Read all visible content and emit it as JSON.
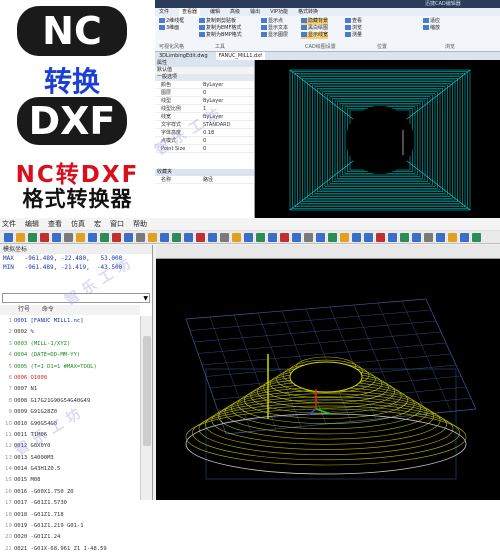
{
  "promo": {
    "nc_text": "NC",
    "convert_text": "转换",
    "dxf_text": "DXF",
    "line1": "NC转DXF",
    "line2": "格式转换器",
    "nc_text_color": "#ffffff",
    "line1_color": "#d8101c",
    "convert_color": "#1c3fd6"
  },
  "cad_window": {
    "title": "迅捷CAD编辑器",
    "tabs": [
      "文件",
      "查看器",
      "编辑",
      "高级",
      "输出",
      "VIP功能",
      "格式转换"
    ],
    "active_tab": "查看器",
    "ribbon": {
      "group1": [
        "2维线框",
        "3维面",
        "可视化风格"
      ],
      "group2": [
        "复制到剪贴板",
        "复制为EMF格式",
        "复制为BMP格式",
        "工具"
      ],
      "group3": [
        "显示点",
        "显示文本",
        "显示图层",
        "CAD绘图设置"
      ],
      "group4": [
        "隐藏背景",
        "黑白绘图",
        "显示线宽",
        "位置"
      ],
      "group5": [
        "查看",
        "浏览",
        "测量"
      ],
      "group6": [
        "适应",
        "缩放",
        "浏览"
      ]
    },
    "file_tabs": [
      "3DLimbingEdit.dwg",
      "FANUC_MILL1.dxf"
    ],
    "props_title": "属性",
    "props_subtitle": "默认值",
    "props_section": "一般选项",
    "properties": [
      {
        "key": "颜色",
        "value": "ByLayer"
      },
      {
        "key": "图层",
        "value": "0"
      },
      {
        "key": "线型",
        "value": "ByLayer"
      },
      {
        "key": "线型比例",
        "value": "1"
      },
      {
        "key": "线宽",
        "value": "ByLayer"
      },
      {
        "key": "文字样式",
        "value": "STANDARD"
      },
      {
        "key": "字体高度",
        "value": "0.18"
      },
      {
        "key": "点模式",
        "value": "0"
      },
      {
        "key": "Point Size",
        "value": "0"
      }
    ],
    "favorites_title": "收藏夹",
    "favorites_cols": [
      "名称",
      "路径"
    ],
    "accent_color": "#00e5e5"
  },
  "nc_editor": {
    "menu": [
      "文件",
      "编辑",
      "查看",
      "仿真",
      "宏",
      "窗口",
      "帮助"
    ],
    "coord_title": "模拟坐标",
    "coord_rows": [
      "MAX   -961.489, -22.480,   53.000",
      "MIN   -961.489, -21.419,  -43.500"
    ],
    "code_header": [
      "行号",
      "命令"
    ],
    "code_lines": [
      {
        "n": "1",
        "text": "O001 [FANUC MILL1.nc]",
        "color": "#1a2fc4"
      },
      {
        "n": "2",
        "text": "O002 %",
        "color": "#333333"
      },
      {
        "n": "3",
        "text": "O003 (MILL-1/XYZ)",
        "color": "#1f8a1f"
      },
      {
        "n": "4",
        "text": "O004 (DATE=DD-MM-YY)",
        "color": "#1f8a1f"
      },
      {
        "n": "5",
        "text": "O005 (T=1 D1=1 #MAX=TOOL)",
        "color": "#1f8a1f"
      },
      {
        "n": "6",
        "text": "O006 O1000",
        "color": "#d81c1c"
      },
      {
        "n": "7",
        "text": "O007 N1",
        "color": "#333333"
      },
      {
        "n": "8",
        "text": "O008 G17G21G90G54G40G49",
        "color": "#333333"
      },
      {
        "n": "9",
        "text": "O009 G91G28Z0",
        "color": "#333333"
      },
      {
        "n": "10",
        "text": "O010 G90G54G0",
        "color": "#333333"
      },
      {
        "n": "11",
        "text": "O011 T1M06",
        "color": "#333333"
      },
      {
        "n": "12",
        "text": "O012 G0X0Y0",
        "color": "#333333"
      },
      {
        "n": "13",
        "text": "O013 S4000M3",
        "color": "#333333"
      },
      {
        "n": "14",
        "text": "O014 G43H1Z0.5",
        "color": "#333333"
      },
      {
        "n": "15",
        "text": "O015 M08",
        "color": "#333333"
      },
      {
        "n": "16",
        "text": "O016 -G00X1.750 Z0",
        "color": "#333333"
      },
      {
        "n": "17",
        "text": "O017 -G01Z1.5730",
        "color": "#333333"
      },
      {
        "n": "18",
        "text": "O018 -G01Z1.718",
        "color": "#333333"
      },
      {
        "n": "19",
        "text": "O019 -G01Z1.219 G01-1",
        "color": "#333333"
      },
      {
        "n": "20",
        "text": "O020 -G01Z1.24",
        "color": "#333333"
      },
      {
        "n": "21",
        "text": "O021 -G01X-68.961 Z1 J-48.59",
        "color": "#333333"
      }
    ],
    "grid_color": "#3a5c9a",
    "part_color": "#d4d400",
    "cut_color": "#c8c8c8"
  },
  "watermark": "智乐工坊"
}
